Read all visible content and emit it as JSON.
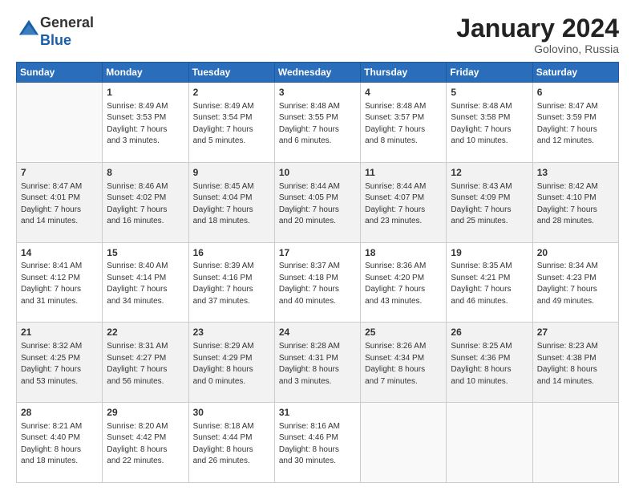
{
  "header": {
    "logo_line1": "General",
    "logo_line2": "Blue",
    "month_title": "January 2024",
    "location": "Golovino, Russia"
  },
  "calendar": {
    "days_of_week": [
      "Sunday",
      "Monday",
      "Tuesday",
      "Wednesday",
      "Thursday",
      "Friday",
      "Saturday"
    ],
    "weeks": [
      [
        {
          "day": "",
          "info": ""
        },
        {
          "day": "1",
          "info": "Sunrise: 8:49 AM\nSunset: 3:53 PM\nDaylight: 7 hours\nand 3 minutes."
        },
        {
          "day": "2",
          "info": "Sunrise: 8:49 AM\nSunset: 3:54 PM\nDaylight: 7 hours\nand 5 minutes."
        },
        {
          "day": "3",
          "info": "Sunrise: 8:48 AM\nSunset: 3:55 PM\nDaylight: 7 hours\nand 6 minutes."
        },
        {
          "day": "4",
          "info": "Sunrise: 8:48 AM\nSunset: 3:57 PM\nDaylight: 7 hours\nand 8 minutes."
        },
        {
          "day": "5",
          "info": "Sunrise: 8:48 AM\nSunset: 3:58 PM\nDaylight: 7 hours\nand 10 minutes."
        },
        {
          "day": "6",
          "info": "Sunrise: 8:47 AM\nSunset: 3:59 PM\nDaylight: 7 hours\nand 12 minutes."
        }
      ],
      [
        {
          "day": "7",
          "info": "Sunrise: 8:47 AM\nSunset: 4:01 PM\nDaylight: 7 hours\nand 14 minutes."
        },
        {
          "day": "8",
          "info": "Sunrise: 8:46 AM\nSunset: 4:02 PM\nDaylight: 7 hours\nand 16 minutes."
        },
        {
          "day": "9",
          "info": "Sunrise: 8:45 AM\nSunset: 4:04 PM\nDaylight: 7 hours\nand 18 minutes."
        },
        {
          "day": "10",
          "info": "Sunrise: 8:44 AM\nSunset: 4:05 PM\nDaylight: 7 hours\nand 20 minutes."
        },
        {
          "day": "11",
          "info": "Sunrise: 8:44 AM\nSunset: 4:07 PM\nDaylight: 7 hours\nand 23 minutes."
        },
        {
          "day": "12",
          "info": "Sunrise: 8:43 AM\nSunset: 4:09 PM\nDaylight: 7 hours\nand 25 minutes."
        },
        {
          "day": "13",
          "info": "Sunrise: 8:42 AM\nSunset: 4:10 PM\nDaylight: 7 hours\nand 28 minutes."
        }
      ],
      [
        {
          "day": "14",
          "info": "Sunrise: 8:41 AM\nSunset: 4:12 PM\nDaylight: 7 hours\nand 31 minutes."
        },
        {
          "day": "15",
          "info": "Sunrise: 8:40 AM\nSunset: 4:14 PM\nDaylight: 7 hours\nand 34 minutes."
        },
        {
          "day": "16",
          "info": "Sunrise: 8:39 AM\nSunset: 4:16 PM\nDaylight: 7 hours\nand 37 minutes."
        },
        {
          "day": "17",
          "info": "Sunrise: 8:37 AM\nSunset: 4:18 PM\nDaylight: 7 hours\nand 40 minutes."
        },
        {
          "day": "18",
          "info": "Sunrise: 8:36 AM\nSunset: 4:20 PM\nDaylight: 7 hours\nand 43 minutes."
        },
        {
          "day": "19",
          "info": "Sunrise: 8:35 AM\nSunset: 4:21 PM\nDaylight: 7 hours\nand 46 minutes."
        },
        {
          "day": "20",
          "info": "Sunrise: 8:34 AM\nSunset: 4:23 PM\nDaylight: 7 hours\nand 49 minutes."
        }
      ],
      [
        {
          "day": "21",
          "info": "Sunrise: 8:32 AM\nSunset: 4:25 PM\nDaylight: 7 hours\nand 53 minutes."
        },
        {
          "day": "22",
          "info": "Sunrise: 8:31 AM\nSunset: 4:27 PM\nDaylight: 7 hours\nand 56 minutes."
        },
        {
          "day": "23",
          "info": "Sunrise: 8:29 AM\nSunset: 4:29 PM\nDaylight: 8 hours\nand 0 minutes."
        },
        {
          "day": "24",
          "info": "Sunrise: 8:28 AM\nSunset: 4:31 PM\nDaylight: 8 hours\nand 3 minutes."
        },
        {
          "day": "25",
          "info": "Sunrise: 8:26 AM\nSunset: 4:34 PM\nDaylight: 8 hours\nand 7 minutes."
        },
        {
          "day": "26",
          "info": "Sunrise: 8:25 AM\nSunset: 4:36 PM\nDaylight: 8 hours\nand 10 minutes."
        },
        {
          "day": "27",
          "info": "Sunrise: 8:23 AM\nSunset: 4:38 PM\nDaylight: 8 hours\nand 14 minutes."
        }
      ],
      [
        {
          "day": "28",
          "info": "Sunrise: 8:21 AM\nSunset: 4:40 PM\nDaylight: 8 hours\nand 18 minutes."
        },
        {
          "day": "29",
          "info": "Sunrise: 8:20 AM\nSunset: 4:42 PM\nDaylight: 8 hours\nand 22 minutes."
        },
        {
          "day": "30",
          "info": "Sunrise: 8:18 AM\nSunset: 4:44 PM\nDaylight: 8 hours\nand 26 minutes."
        },
        {
          "day": "31",
          "info": "Sunrise: 8:16 AM\nSunset: 4:46 PM\nDaylight: 8 hours\nand 30 minutes."
        },
        {
          "day": "",
          "info": ""
        },
        {
          "day": "",
          "info": ""
        },
        {
          "day": "",
          "info": ""
        }
      ]
    ]
  }
}
